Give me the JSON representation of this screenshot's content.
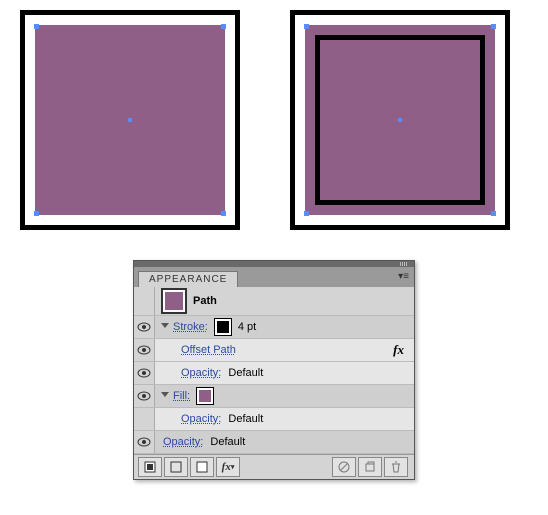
{
  "panel": {
    "title": "APPEARANCE",
    "object_type": "Path",
    "rows": {
      "stroke_label": "Stroke:",
      "stroke_weight": "4 pt",
      "offset_path": "Offset Path",
      "fill_label": "Fill:",
      "opacity_label": "Opacity:",
      "opacity_value": "Default"
    },
    "colors": {
      "fill": "#905f88",
      "stroke": "#000000"
    },
    "footer_fx": "fx"
  }
}
